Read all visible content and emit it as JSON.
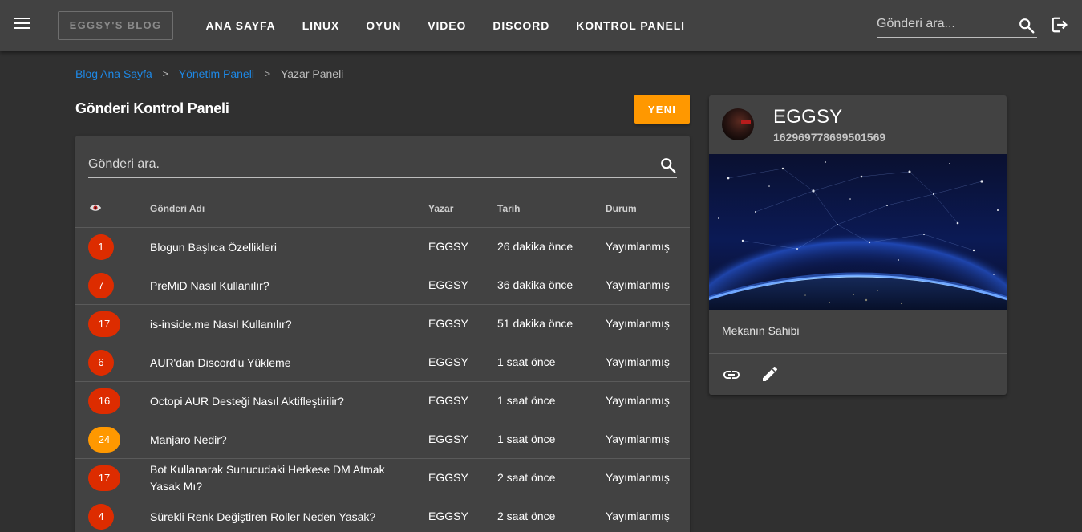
{
  "header": {
    "brand": "EGGSY'S BLOG",
    "nav": [
      "ANA SAYFA",
      "LINUX",
      "OYUN",
      "VIDEO",
      "DISCORD",
      "KONTROL PANELI"
    ],
    "search_placeholder": "Gönderi ara...",
    "icons": [
      "menu-icon",
      "search-icon",
      "logout-icon"
    ]
  },
  "breadcrumb": {
    "items": [
      "Blog Ana Sayfa",
      "Yönetim Paneli",
      "Yazar Paneli"
    ],
    "separator": ">"
  },
  "panel": {
    "title": "Gönderi Kontrol Paneli",
    "new_button": "YENI",
    "search_placeholder": "Gönderi ara.",
    "columns": {
      "views": "eye-icon",
      "name": "Gönderi Adı",
      "author": "Yazar",
      "date": "Tarih",
      "status": "Durum"
    },
    "rows": [
      {
        "views": "1",
        "name": "Blogun Başlıca Özellikleri",
        "author": "EGGSY",
        "date": "26 dakika önce",
        "status": "Yayımlanmış"
      },
      {
        "views": "7",
        "name": "PreMiD Nasıl Kullanılır?",
        "author": "EGGSY",
        "date": "36 dakika önce",
        "status": "Yayımlanmış"
      },
      {
        "views": "17",
        "name": "is-inside.me Nasıl Kullanılır?",
        "author": "EGGSY",
        "date": "51 dakika önce",
        "status": "Yayımlanmış"
      },
      {
        "views": "6",
        "name": "AUR'dan Discord'u Yükleme",
        "author": "EGGSY",
        "date": "1 saat önce",
        "status": "Yayımlanmış"
      },
      {
        "views": "16",
        "name": "Octopi AUR Desteği Nasıl Aktifleştirilir?",
        "author": "EGGSY",
        "date": "1 saat önce",
        "status": "Yayımlanmış"
      },
      {
        "views": "24",
        "name": "Manjaro Nedir?",
        "author": "EGGSY",
        "date": "1 saat önce",
        "status": "Yayımlanmış"
      },
      {
        "views": "17",
        "name": "Bot Kullanarak Sunucudaki Herkese DM Atmak Yasak Mı?",
        "author": "EGGSY",
        "date": "2 saat önce",
        "status": "Yayımlanmış"
      },
      {
        "views": "4",
        "name": "Sürekli Renk Değiştiren Roller Neden Yasak?",
        "author": "EGGSY",
        "date": "2 saat önce",
        "status": "Yayımlanmış"
      }
    ]
  },
  "profile": {
    "name": "EGGSY",
    "id": "162969778699501569",
    "role": "Mekanın Sahibi",
    "actions": [
      "link-icon",
      "edit-icon"
    ]
  },
  "colors": {
    "background": "#303030",
    "surface": "#424242",
    "accent": "#ff9800",
    "badge_red": "#dd2c00",
    "link": "#1e88e5"
  }
}
